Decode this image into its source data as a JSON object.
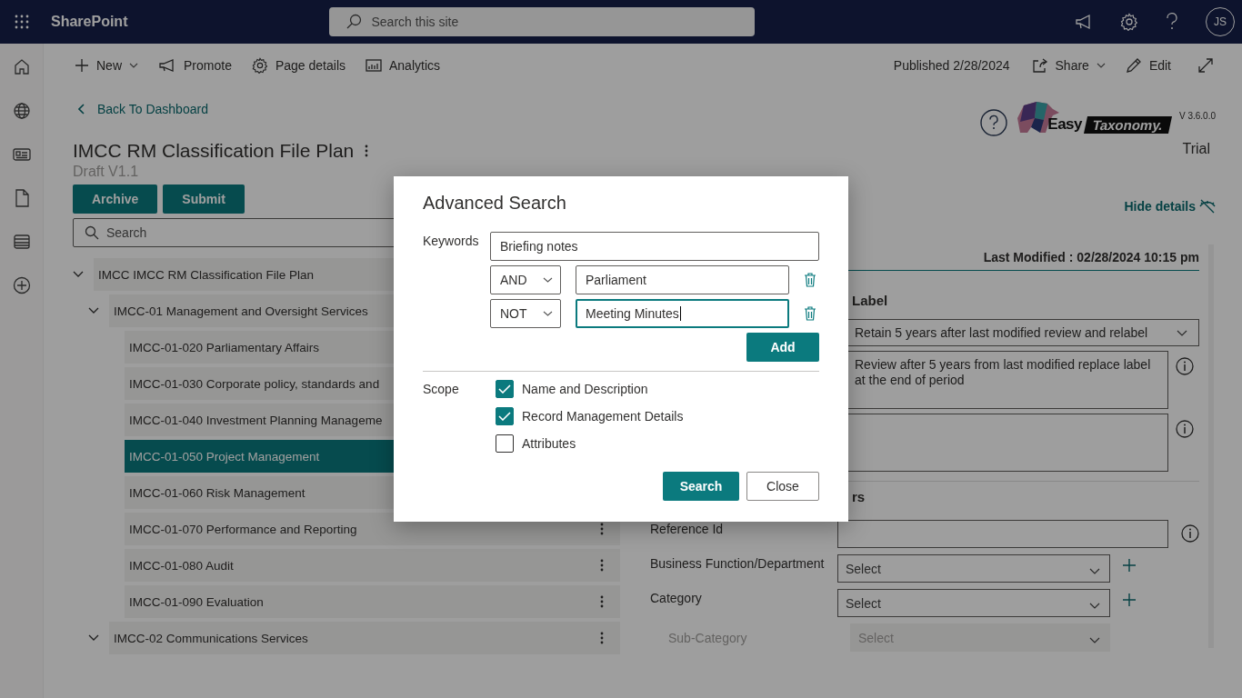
{
  "top_bar": {
    "app_name": "SharePoint",
    "search": {
      "placeholder": "Search this site"
    },
    "avatar": "JS"
  },
  "command_bar": {
    "left": [
      {
        "label": "New",
        "dropdown": true
      },
      {
        "label": "Promote",
        "dropdown": false
      },
      {
        "label": "Page details",
        "dropdown": false
      },
      {
        "label": "Analytics",
        "dropdown": false
      }
    ],
    "published": "Published 2/28/2024",
    "right": [
      {
        "label": "Share",
        "dropdown": true
      },
      {
        "label": "Edit",
        "dropdown": false
      }
    ]
  },
  "back_link": "Back To Dashboard",
  "title": "IMCC RM Classification File Plan",
  "subtitle": "Draft V1.1",
  "actions": [
    "Archive",
    "Submit"
  ],
  "tree_search": {
    "placeholder": "Search"
  },
  "tree": [
    {
      "label": "IMCC IMCC RM Classification File Plan",
      "expanded": true,
      "selected": false,
      "children": [
        {
          "label": "IMCC-01 Management and Oversight Services",
          "expanded": true,
          "selected": false,
          "children": [
            {
              "label": "IMCC-01-020 Parliamentary Affairs",
              "selected": false
            },
            {
              "label": "IMCC-01-030 Corporate policy, standards and",
              "selected": false
            },
            {
              "label": "IMCC-01-040 Investment Planning Manageme",
              "selected": false
            },
            {
              "label": "IMCC-01-050 Project Management",
              "selected": true
            },
            {
              "label": "IMCC-01-060 Risk Management",
              "selected": false
            },
            {
              "label": "IMCC-01-070 Performance and Reporting",
              "selected": false,
              "menu": true
            },
            {
              "label": "IMCC-01-080 Audit",
              "selected": false,
              "menu": true
            },
            {
              "label": "IMCC-01-090 Evaluation",
              "selected": false,
              "menu": true
            }
          ]
        },
        {
          "label": "IMCC-02 Communications Services",
          "expanded": true,
          "selected": false,
          "menu": true
        }
      ]
    }
  ],
  "brand": {
    "logo_word_1": "Easy",
    "logo_word_2": "Taxonomy.",
    "version": "V 3.6.0.0",
    "license": "Trial"
  },
  "hide_details": "Hide details",
  "details": {
    "last_modified": "Last Modified : 02/28/2024 10:15 pm",
    "section_1": "Label",
    "retention": "Retain 5 years after last modified review and relabel",
    "notes": [
      {
        "value": "Review after 5 years from last modified replace label at the end of period",
        "info": true
      },
      {
        "info": true
      }
    ],
    "section_2": "rs",
    "fields": [
      {
        "label": "Reference Id",
        "kind": "text",
        "info": true,
        "add": false,
        "disabled": false
      },
      {
        "label": "Business Function/Department",
        "kind": "select",
        "placeholder": "Select",
        "info": false,
        "add": true,
        "disabled": false
      },
      {
        "label": "Category",
        "kind": "select",
        "placeholder": "Select",
        "info": false,
        "add": true,
        "disabled": false
      },
      {
        "label": "Sub-Category",
        "kind": "select",
        "placeholder": "Select",
        "info": false,
        "add": false,
        "disabled": true
      }
    ]
  },
  "dialog": {
    "title": "Advanced Search",
    "keywords_label": "Keywords",
    "keyword": "Briefing notes",
    "conditions": [
      {
        "operator": "AND",
        "value": "Parliament",
        "focused": false
      },
      {
        "operator": "NOT",
        "value": "Meeting Minutes",
        "focused": true
      }
    ],
    "add_button": "Add",
    "scope_label": "Scope",
    "scope": [
      {
        "label": "Name and Description",
        "checked": true
      },
      {
        "label": "Record Management Details",
        "checked": true
      },
      {
        "label": "Attributes",
        "checked": false
      }
    ],
    "buttons": [
      {
        "label": "Search",
        "kind": "primary"
      },
      {
        "label": "Close",
        "kind": "secondary"
      }
    ]
  }
}
